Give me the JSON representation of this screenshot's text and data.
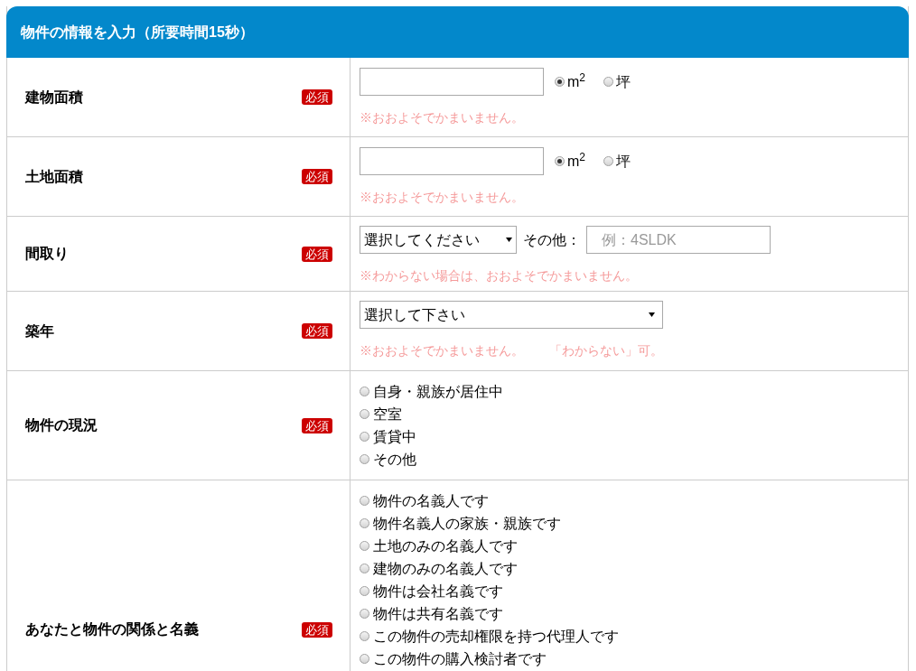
{
  "header": {
    "title": "物件の情報を入力（所要時間15秒）"
  },
  "rows": [
    {
      "kind": "area",
      "label": "建物面積",
      "badge": "必須",
      "value": "",
      "units": [
        {
          "label": "m$^{2}$",
          "selected": true
        },
        {
          "label": "坪",
          "selected": false
        }
      ],
      "notes": [
        "※おおよそでかまいません。"
      ]
    },
    {
      "kind": "area",
      "label": "土地面積",
      "badge": "必須",
      "value": "",
      "units": [
        {
          "label": "m$^{2}$",
          "selected": true
        },
        {
          "label": "坪",
          "selected": false
        }
      ],
      "notes": [
        "※おおよそでかまいません。"
      ]
    },
    {
      "kind": "layout",
      "label": "間取り",
      "badge": "必須",
      "select": "選択してください",
      "other_label": "その他：",
      "other_placeholder": "例：4SLDK",
      "notes": [
        "※わからない場合は、おおよそでかまいません。"
      ]
    },
    {
      "kind": "select",
      "label": "築年",
      "badge": "必須",
      "select": "選択して下さい",
      "notes": [
        "※おおよそでかまいません。",
        "「わからない」可。"
      ]
    },
    {
      "kind": "radios",
      "label": "物件の現況",
      "badge": "必須",
      "options": [
        {
          "label": "自身・親族が居住中",
          "selected": false
        },
        {
          "label": "空室",
          "selected": false
        },
        {
          "label": "賃貸中",
          "selected": false
        },
        {
          "label": "その他",
          "selected": false
        }
      ]
    },
    {
      "kind": "radios",
      "label": "あなたと物件の関係と名義",
      "badge": "必須",
      "options": [
        {
          "label": "物件の名義人です",
          "selected": false
        },
        {
          "label": "物件名義人の家族・親族です",
          "selected": false
        },
        {
          "label": "土地のみの名義人です",
          "selected": false
        },
        {
          "label": "建物のみの名義人です",
          "selected": false
        },
        {
          "label": "物件は会社名義です",
          "selected": false
        },
        {
          "label": "物件は共有名義です",
          "selected": false
        },
        {
          "label": "この物件の売却権限を持つ代理人です",
          "selected": false
        },
        {
          "label": "この物件の購入検討者です",
          "selected": false
        }
      ]
    }
  ]
}
